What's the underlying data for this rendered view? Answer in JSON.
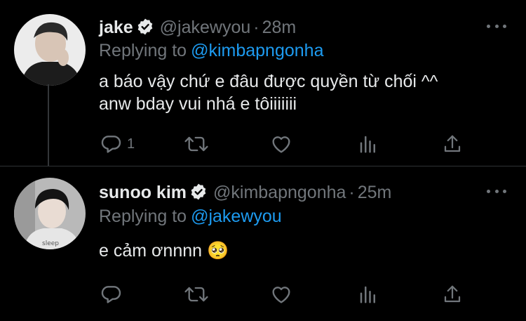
{
  "tweets": [
    {
      "name": "jake",
      "handle": "@jakewyou",
      "dot": "·",
      "time": "28m",
      "replying_to_label": "Replying to",
      "replying_to": "@kimbapngonha",
      "text": "a báo vậy chứ e đâu được quyền từ chối ^^\nanw bday vui nhá e tôiiiiiii",
      "reply_count": "1",
      "verified": true
    },
    {
      "name": "sunoo kim",
      "handle": "@kimbapngonha",
      "dot": "·",
      "time": "25m",
      "replying_to_label": "Replying to",
      "replying_to": "@jakewyou",
      "text": "e cảm ơnnnn 🥺",
      "reply_count": "",
      "verified": true
    }
  ],
  "colors": {
    "background": "#000000",
    "text": "#e7e9ea",
    "muted": "#71767b",
    "accent": "#1d9bf0",
    "divider": "#2f3336"
  },
  "icons": {
    "reply": "reply-icon",
    "retweet": "retweet-icon",
    "like": "heart-icon",
    "analytics": "analytics-icon",
    "share": "share-icon",
    "more": "more-icon",
    "verified": "verified-badge-icon"
  }
}
